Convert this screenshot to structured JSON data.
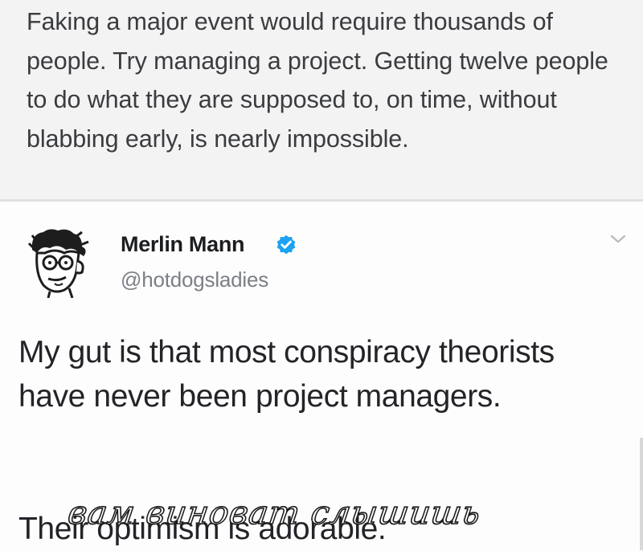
{
  "quote": {
    "text": "Faking a major event would require thousands of people.  Try managing a project.  Getting twelve people to do what they are supposed to, on time, without blabbing early, is nearly impossible."
  },
  "tweet": {
    "author": {
      "name": "Merlin Mann",
      "handle": "@hotdogsladies",
      "verified": true
    },
    "body_line1": "My gut is that most conspiracy theorists have never been project managers.",
    "body_line2": "Their optimism is adorable."
  },
  "watermark": {
    "text": "вам виноват слышишь"
  },
  "colors": {
    "verified_badge": "#1da1f2",
    "background": "#f3f3f3"
  },
  "icons": {
    "avatar": "caricature-avatar",
    "verified": "verified-badge-icon",
    "menu": "chevron-down-icon"
  }
}
